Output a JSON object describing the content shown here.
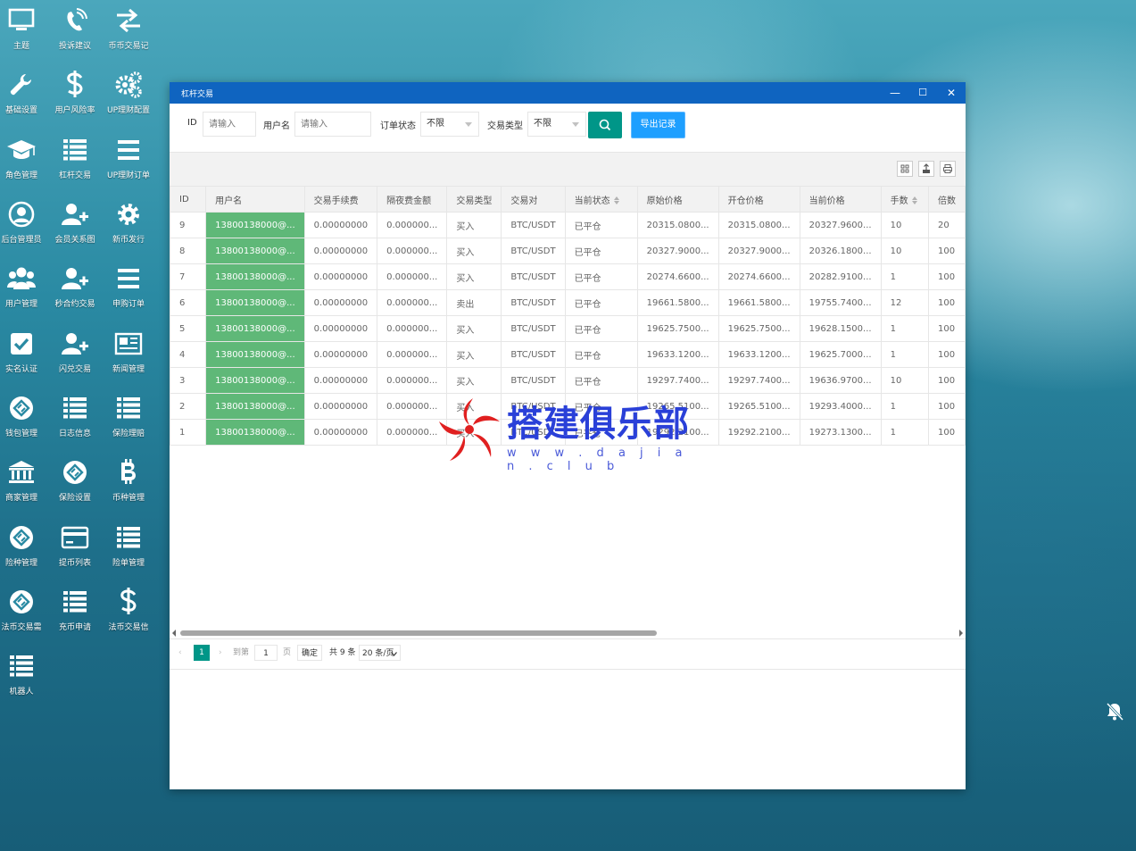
{
  "desktop_icons": [
    {
      "label": "主题",
      "icon": "monitor-icon"
    },
    {
      "label": "投诉建议",
      "icon": "phone-icon"
    },
    {
      "label": "币币交易记",
      "icon": "exchange-icon"
    },
    {
      "label": "基础设置",
      "icon": "wrench-icon"
    },
    {
      "label": "用户风险率",
      "icon": "dollar-icon"
    },
    {
      "label": "UP理财配置",
      "icon": "gears-icon"
    },
    {
      "label": "角色管理",
      "icon": "graduation-cap-icon"
    },
    {
      "label": "杠杆交易",
      "icon": "list-icon"
    },
    {
      "label": "UP理财订单",
      "icon": "menu-icon"
    },
    {
      "label": "后台管理员",
      "icon": "user-circle-icon"
    },
    {
      "label": "会员关系图",
      "icon": "user-plus-icon"
    },
    {
      "label": "新币发行",
      "icon": "gear-icon"
    },
    {
      "label": "用户管理",
      "icon": "users-icon"
    },
    {
      "label": "秒合约交易",
      "icon": "user-plus-icon"
    },
    {
      "label": "申购订单",
      "icon": "menu-icon"
    },
    {
      "label": "实名认证",
      "icon": "checkbox-icon"
    },
    {
      "label": "闪兑交易",
      "icon": "user-plus-icon"
    },
    {
      "label": "新闻管理",
      "icon": "newspaper-icon"
    },
    {
      "label": "钱包管理",
      "icon": "diamond-badge-icon"
    },
    {
      "label": "日志信息",
      "icon": "list-icon"
    },
    {
      "label": "保险理赔",
      "icon": "list-icon"
    },
    {
      "label": "商家管理",
      "icon": "bank-icon"
    },
    {
      "label": "保险设置",
      "icon": "diamond-badge-icon"
    },
    {
      "label": "币种管理",
      "icon": "bitcoin-icon"
    },
    {
      "label": "险种管理",
      "icon": "diamond-badge-icon"
    },
    {
      "label": "提币列表",
      "icon": "credit-card-icon"
    },
    {
      "label": "险单管理",
      "icon": "list-icon"
    },
    {
      "label": "法币交易需",
      "icon": "diamond-badge-icon"
    },
    {
      "label": "充币申请",
      "icon": "list-icon"
    },
    {
      "label": "法币交易信",
      "icon": "dollar-icon"
    },
    {
      "label": "机器人",
      "icon": "list-icon"
    }
  ],
  "window": {
    "title": "杠杆交易",
    "controls": {
      "minimize": "—",
      "maximize": "☐",
      "close": "✕"
    }
  },
  "filters": {
    "id_label": "ID",
    "id_placeholder": "请输入",
    "username_label": "用户名",
    "username_placeholder": "请输入",
    "order_status_label": "订单状态",
    "order_status_value": "不限",
    "trade_type_label": "交易类型",
    "trade_type_value": "不限",
    "export_label": "导出记录"
  },
  "table": {
    "columns": [
      "ID",
      "用户名",
      "交易手续费",
      "隔夜费金额",
      "交易类型",
      "交易对",
      "当前状态",
      "原始价格",
      "开仓价格",
      "当前价格",
      "手数",
      "倍数"
    ],
    "rows": [
      [
        "9",
        "13800138000@...",
        "0.00000000",
        "0.000000...",
        "买入",
        "BTC/USDT",
        "已平仓",
        "20315.0800...",
        "20315.0800...",
        "20327.9600...",
        "10",
        "20"
      ],
      [
        "8",
        "13800138000@...",
        "0.00000000",
        "0.000000...",
        "买入",
        "BTC/USDT",
        "已平仓",
        "20327.9000...",
        "20327.9000...",
        "20326.1800...",
        "10",
        "100"
      ],
      [
        "7",
        "13800138000@...",
        "0.00000000",
        "0.000000...",
        "买入",
        "BTC/USDT",
        "已平仓",
        "20274.6600...",
        "20274.6600...",
        "20282.9100...",
        "1",
        "100"
      ],
      [
        "6",
        "13800138000@...",
        "0.00000000",
        "0.000000...",
        "卖出",
        "BTC/USDT",
        "已平仓",
        "19661.5800...",
        "19661.5800...",
        "19755.7400...",
        "12",
        "100"
      ],
      [
        "5",
        "13800138000@...",
        "0.00000000",
        "0.000000...",
        "买入",
        "BTC/USDT",
        "已平仓",
        "19625.7500...",
        "19625.7500...",
        "19628.1500...",
        "1",
        "100"
      ],
      [
        "4",
        "13800138000@...",
        "0.00000000",
        "0.000000...",
        "买入",
        "BTC/USDT",
        "已平仓",
        "19633.1200...",
        "19633.1200...",
        "19625.7000...",
        "1",
        "100"
      ],
      [
        "3",
        "13800138000@...",
        "0.00000000",
        "0.000000...",
        "买入",
        "BTC/USDT",
        "已平仓",
        "19297.7400...",
        "19297.7400...",
        "19636.9700...",
        "10",
        "100"
      ],
      [
        "2",
        "13800138000@...",
        "0.00000000",
        "0.000000...",
        "买入",
        "BTC/USDT",
        "已平仓",
        "19265.5100...",
        "19265.5100...",
        "19293.4000...",
        "1",
        "100"
      ],
      [
        "1",
        "13800138000@...",
        "0.00000000",
        "0.000000...",
        "买入",
        "BTC/USDT",
        "已平仓",
        "19292.2100...",
        "19292.2100...",
        "19273.1300...",
        "1",
        "100"
      ]
    ]
  },
  "pagination": {
    "prev": "‹",
    "current_page": "1",
    "next": "›",
    "goto_label": "到第",
    "goto_value": "1",
    "page_unit": "页",
    "confirm": "确定",
    "total": "共 9 条",
    "page_size": "20 条/页"
  },
  "watermark": {
    "title": "搭建俱乐部",
    "url": "w w w . d a j i a n . c l u b"
  },
  "colors": {
    "titlebar": "#0f64c0",
    "search_button": "#009688",
    "export_button": "#1e9fff",
    "username_cell": "#5fb878"
  }
}
